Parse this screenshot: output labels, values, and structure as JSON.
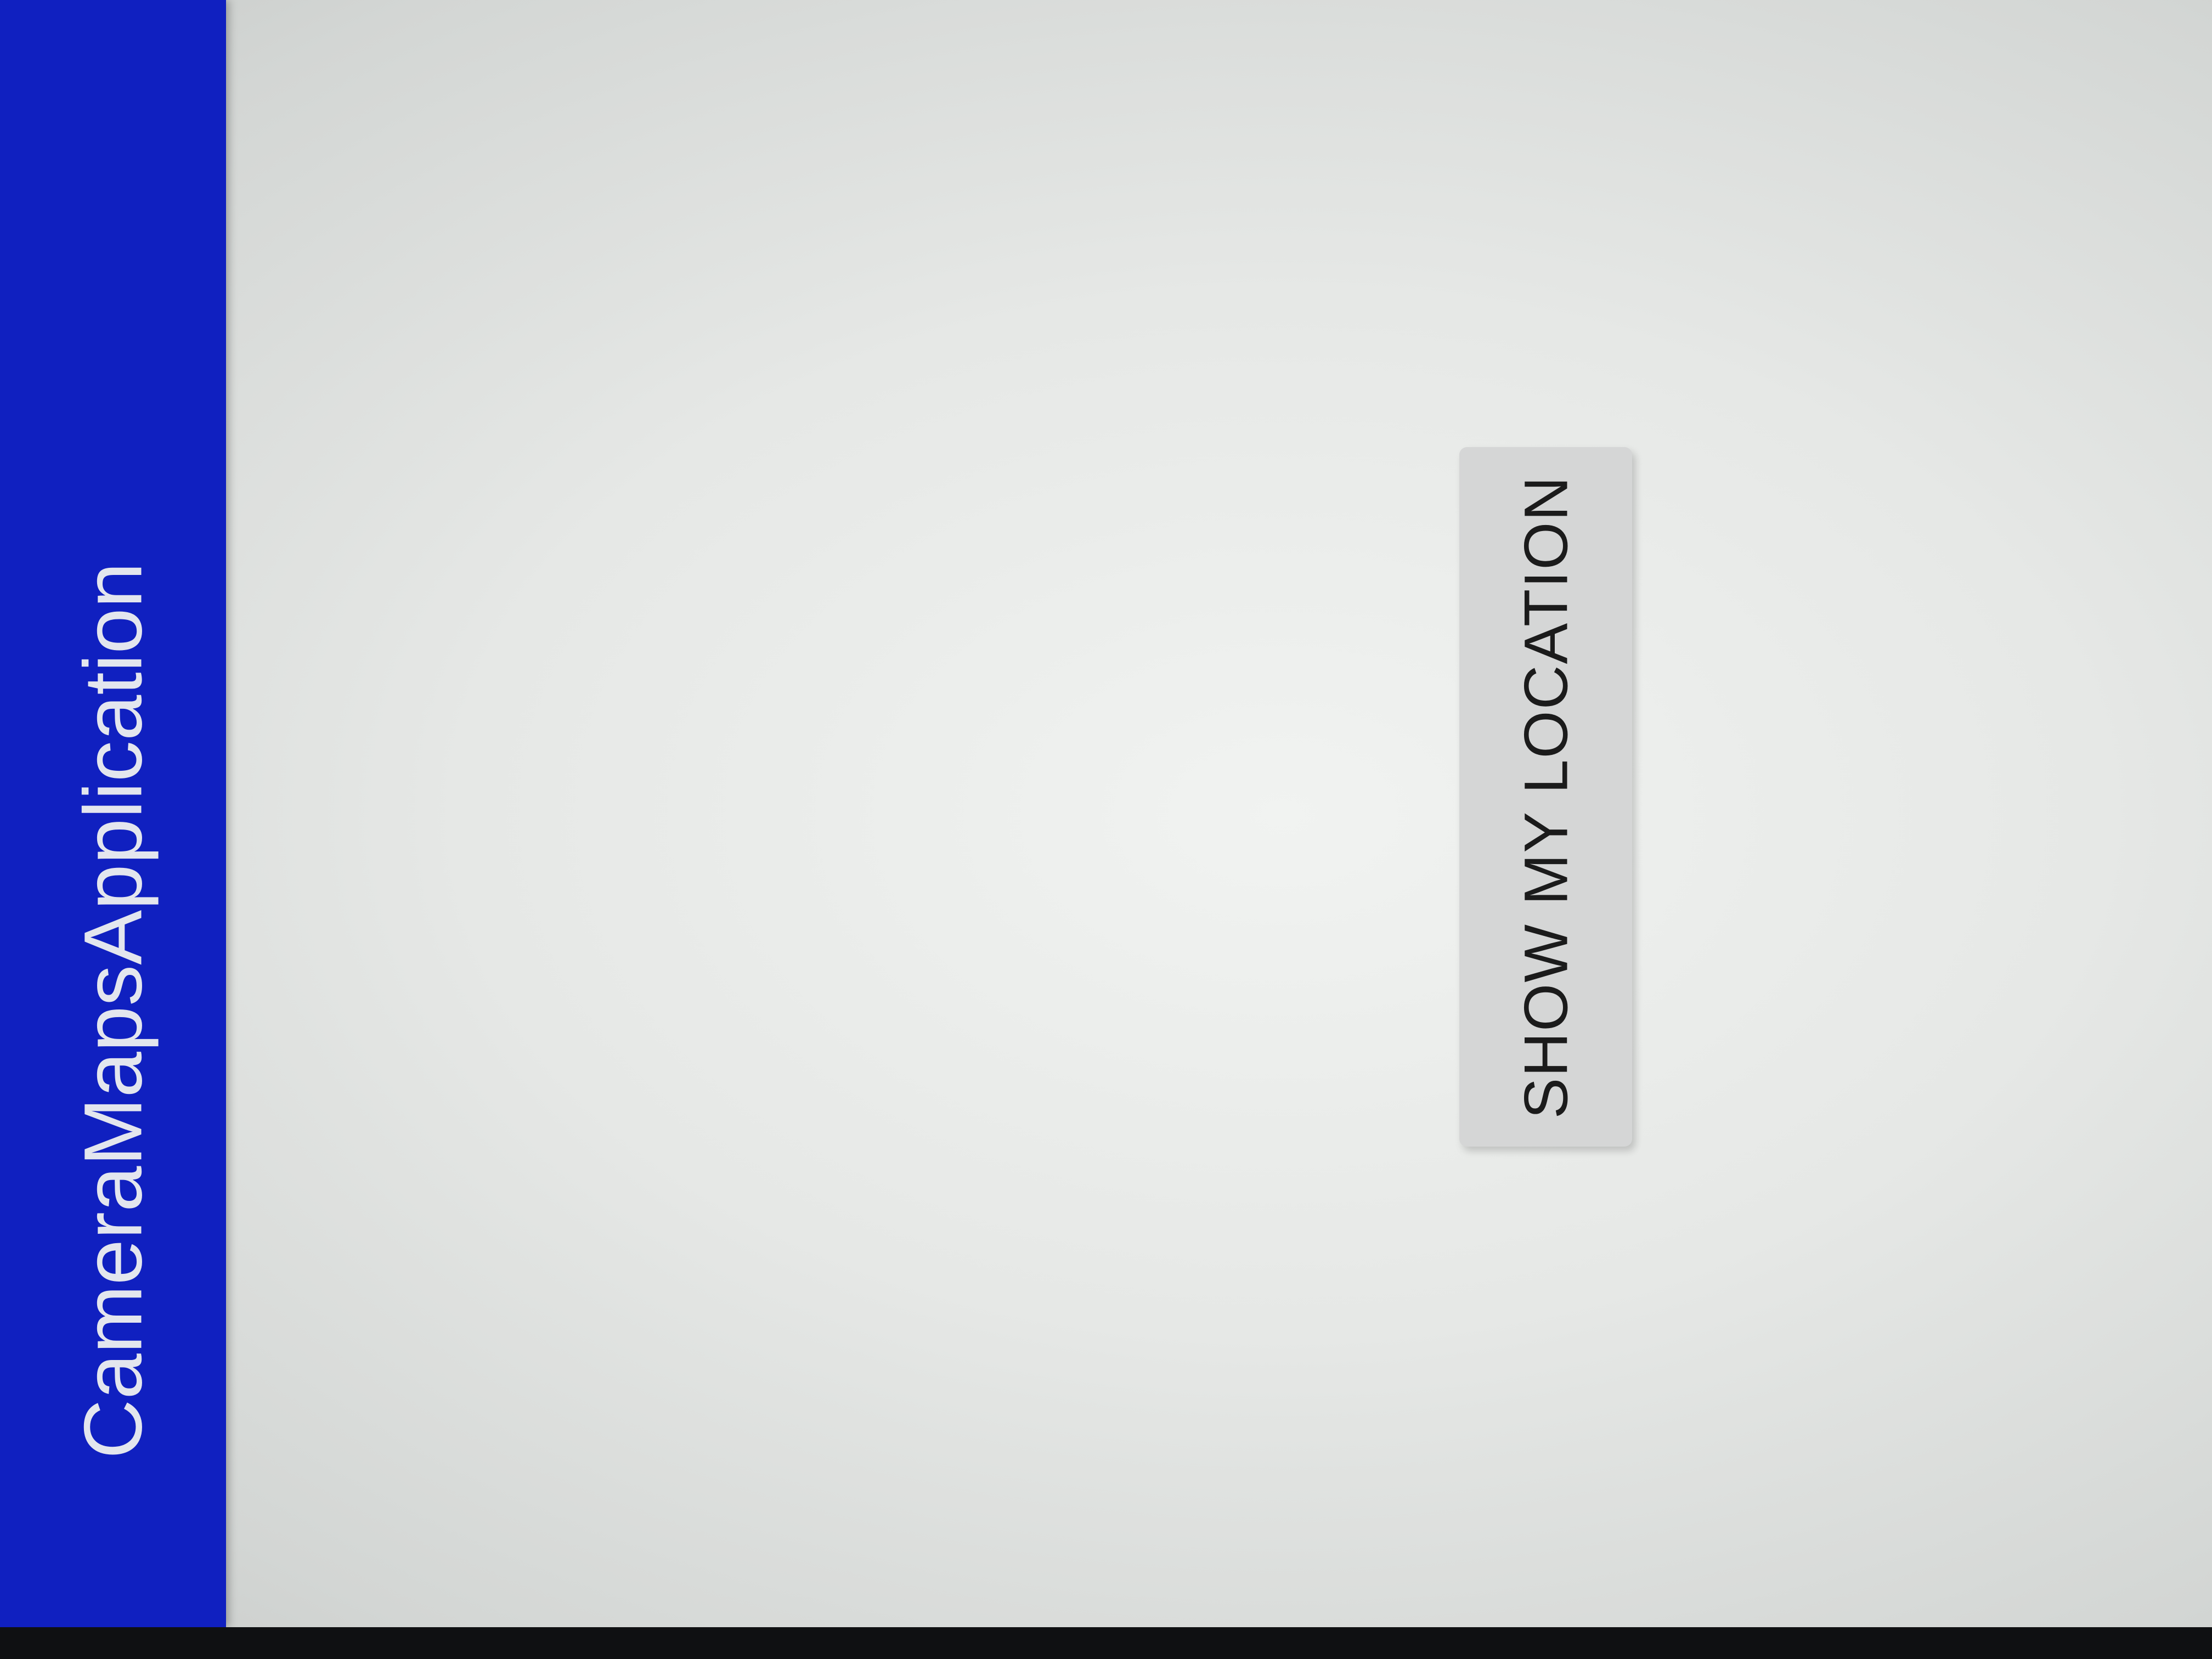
{
  "app": {
    "title": "CameraMapsApplication"
  },
  "main": {
    "show_location_button": {
      "label": "SHOW MY LOCATION"
    }
  },
  "colors": {
    "app_bar": "#1020c0",
    "app_title_text": "#e3e6ee",
    "content_background": "#e6e8e6",
    "button_background": "#d5d6d6",
    "button_text": "#1b1b1b"
  }
}
